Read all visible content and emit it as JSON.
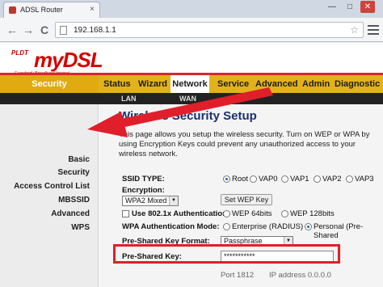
{
  "browser": {
    "tab_title": "ADSL Router",
    "tab_close": "×",
    "url": "192.168.1.1",
    "back": "←",
    "forward": "→",
    "reload": "C",
    "star": "☆",
    "win_min": "—",
    "win_max": "□",
    "win_close": "✕"
  },
  "logo": {
    "brand": "PLDT",
    "product": "myDSL",
    "tagline": "Everybody Broadband Internet"
  },
  "nav": {
    "section": "Security",
    "tabs": [
      "Status",
      "Wizard",
      "Network",
      "Service",
      "Advanced",
      "Admin",
      "Diagnostic"
    ],
    "active_tab": "Network",
    "subtabs": [
      "LAN",
      "WAN"
    ]
  },
  "sidebar": {
    "items": [
      "Basic",
      "Security",
      "Access Control List",
      "MBSSID",
      "Advanced",
      "WPS"
    ]
  },
  "content": {
    "title": "Wireless Security Setup",
    "description": "This page allows you setup the wireless security. Turn on WEP or WPA by using Encryption Keys could prevent any unauthorized access to your wireless network.",
    "ssid_type_label": "SSID TYPE:",
    "ssid_options": [
      "Root",
      "VAP0",
      "VAP1",
      "VAP2",
      "VAP3"
    ],
    "encryption_label": "Encryption:",
    "encryption_value": "WPA2 Mixed",
    "wep_button": "Set WEP Key",
    "use_8021x_label": "Use 802.1x Authentication",
    "wep64": "WEP 64bits",
    "wep128": "WEP 128bits",
    "wpa_auth_label": "WPA Authentication Mode:",
    "wpa_opt_enterprise": "Enterprise (RADIUS)",
    "wpa_opt_personal": "Personal (Pre-Shared",
    "psk_format_label": "Pre-Shared Key Format:",
    "psk_format_value": "Passphrase",
    "psk_label": "Pre-Shared Key:",
    "psk_value": "***********",
    "bottom_partial_1": "Port 1812",
    "bottom_partial_2": "IP address 0.0.0.0"
  },
  "colors": {
    "accent_red": "#d62828",
    "nav_gold": "#e2b21a",
    "title_blue": "#1c2f6e"
  }
}
